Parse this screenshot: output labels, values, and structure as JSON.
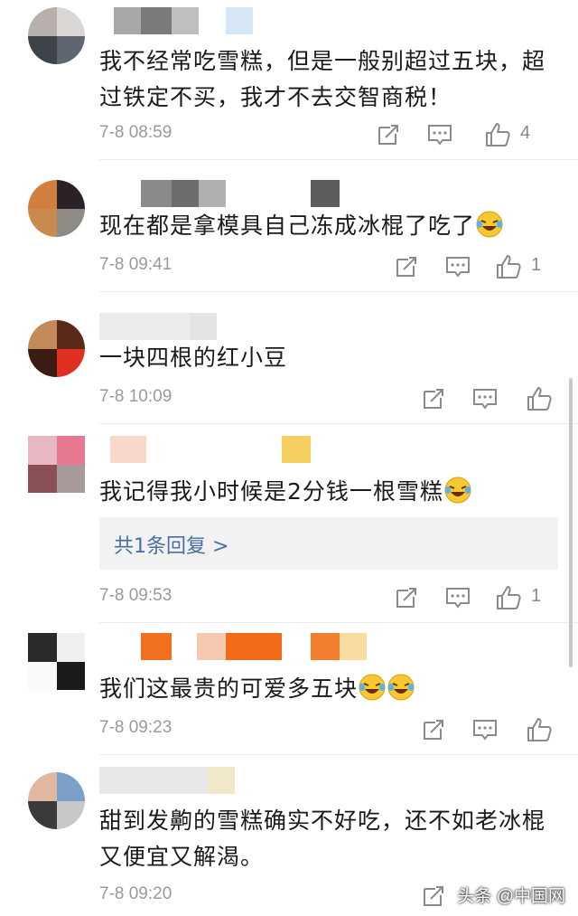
{
  "comments": [
    {
      "text": "我不经常吃雪糕，但是一般别超过五块，超过铁定不买，我才不去交智商税！",
      "time": "7-8 08:59",
      "likes": "4",
      "avatar_colors": [
        "#b8b0ad",
        "#d9d6d4",
        "#3e4349",
        "#5f6670"
      ],
      "name_colors": [
        "#a8a8a8",
        "#7a7a7a",
        "#bfbfbf",
        "#d6e6f5"
      ]
    },
    {
      "text": "现在都是拿模具自己冻成冰棍了吃了",
      "time": "7-8 09:41",
      "likes": "1",
      "avatar_colors": [
        "#d07f3f",
        "#2b2228",
        "#c98a4d",
        "#8e8a86"
      ],
      "name_colors": [
        "#8a8a8a",
        "#6d6d6d",
        "#b0b0b0",
        "#5d5d5d"
      ]
    },
    {
      "text": "一块四根的红小豆",
      "time": "7-8 10:09",
      "likes": "",
      "avatar_colors": [
        "#c48a5a",
        "#5a2a18",
        "#3a1c12",
        "#e03020"
      ],
      "name_colors": [
        "#ececec",
        "#e4e4e4"
      ]
    },
    {
      "text": "我记得我小时候是2分钱一根雪糕",
      "time": "7-8 09:53",
      "likes": "1",
      "avatar_colors": [
        "#e8b8c2",
        "#e87890",
        "#8a5058",
        "#a89a9a"
      ],
      "name_colors": [
        "#f8d8c8",
        "#f5d060"
      ],
      "reply_label": "共1条回复 >"
    },
    {
      "text": "我们这最贵的可爱多五块",
      "time": "7-8 09:23",
      "likes": "",
      "avatar_colors": [
        "#2a2a2a",
        "#f0f0f0",
        "#fafafa",
        "#1a1a1a"
      ],
      "name_colors": [
        "#f07020",
        "#f5c8b0",
        "#f06a18",
        "#f08030",
        "#f8dca0"
      ]
    },
    {
      "text": "甜到发齁的雪糕确实不好吃，还不如老冰棍又便宜又解渴。",
      "time": "7-8 09:20",
      "likes": "",
      "avatar_colors": [
        "#e0b8a0",
        "#7aa0c8",
        "#3a3a3a",
        "#c8c8c8"
      ],
      "name_colors": [
        "#e8e8e8",
        "#f0e8c8"
      ]
    }
  ],
  "watermark": "头条 @中国网",
  "icon_color": "#8a8a8a"
}
